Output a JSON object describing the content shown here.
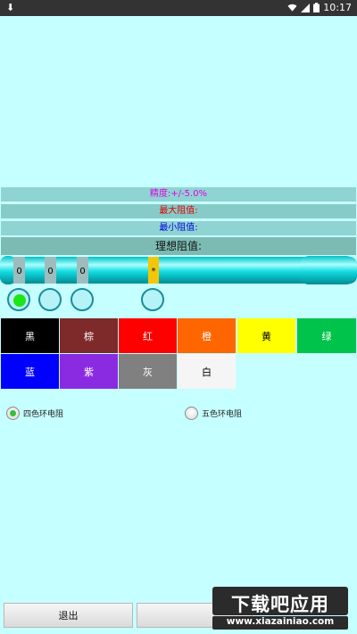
{
  "status_bar": {
    "left_text": "⬇",
    "time": "10:17"
  },
  "info": {
    "precision": "精度:+/-5.0%",
    "max": "最大阻值:",
    "min": "最小阻值:",
    "ideal": "理想阻值:"
  },
  "resistor": {
    "bands": [
      {
        "label": "0",
        "color": "#9dbcbe"
      },
      {
        "label": "0",
        "color": "#9dbcbe"
      },
      {
        "label": "0",
        "color": "#9dbcbe"
      },
      {
        "label": "*",
        "color": "#f3c60a"
      }
    ]
  },
  "colors": [
    {
      "label": "黑",
      "bg": "#000000",
      "fg": "#ffffff"
    },
    {
      "label": "棕",
      "bg": "#7f2a2a",
      "fg": "#ffffff"
    },
    {
      "label": "红",
      "bg": "#ff0000",
      "fg": "#ffffff"
    },
    {
      "label": "橙",
      "bg": "#ff6600",
      "fg": "#ffffff"
    },
    {
      "label": "黄",
      "bg": "#ffff00",
      "fg": "#000000"
    },
    {
      "label": "绿",
      "bg": "#00c34b",
      "fg": "#ffffff"
    },
    {
      "label": "蓝",
      "bg": "#0000ff",
      "fg": "#ffffff"
    },
    {
      "label": "紫",
      "bg": "#8a2be2",
      "fg": "#ffffff"
    },
    {
      "label": "灰",
      "bg": "#808080",
      "fg": "#ffffff"
    },
    {
      "label": "白",
      "bg": "#f5f5f5",
      "fg": "#000000"
    }
  ],
  "mode": {
    "four_band": "四色环电阻",
    "five_band": "五色环电阻",
    "selected": "four_band"
  },
  "buttons": {
    "exit": "退出",
    "second": ""
  },
  "watermark": {
    "title": "下载吧应用",
    "url": "www.xiazainiao.com"
  }
}
